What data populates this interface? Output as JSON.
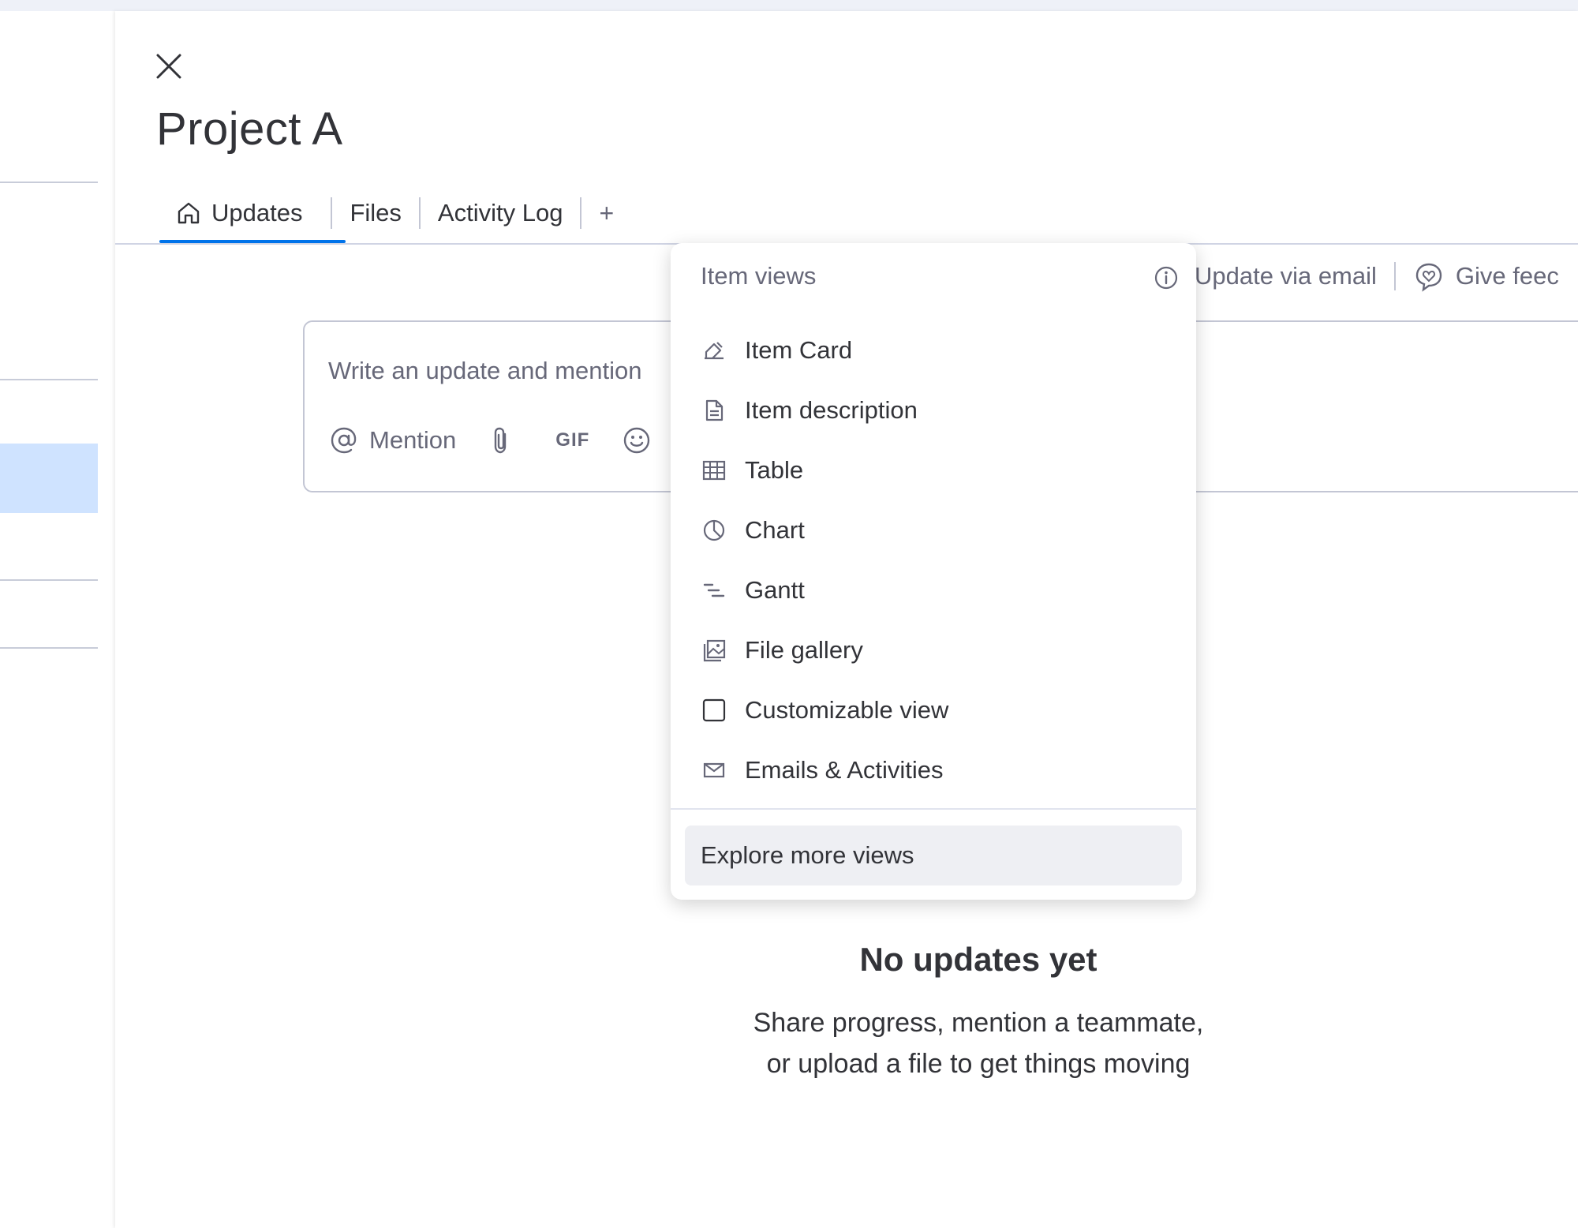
{
  "panel": {
    "title": "Project A"
  },
  "tabs": [
    {
      "label": "Updates",
      "icon": "home-icon",
      "active": true
    },
    {
      "label": "Files"
    },
    {
      "label": "Activity Log"
    }
  ],
  "tab_add_label": "+",
  "right_actions": {
    "update_via_email": "Update via email",
    "give_feedback": "Give feec"
  },
  "composer": {
    "placeholder": "Write an update and mention",
    "mention_label": "Mention",
    "gif_label": "GIF"
  },
  "dropdown": {
    "header": "Item views",
    "items": [
      {
        "label": "Item Card",
        "icon": "item-card-icon"
      },
      {
        "label": "Item description",
        "icon": "document-icon"
      },
      {
        "label": "Table",
        "icon": "table-icon"
      },
      {
        "label": "Chart",
        "icon": "chart-icon"
      },
      {
        "label": "Gantt",
        "icon": "gantt-icon"
      },
      {
        "label": "File gallery",
        "icon": "gallery-icon"
      },
      {
        "label": "Customizable view",
        "icon": "square-icon"
      },
      {
        "label": "Emails & Activities",
        "icon": "mail-icon"
      }
    ],
    "explore": "Explore more views"
  },
  "empty_state": {
    "title": "No updates yet",
    "line1": "Share progress, mention a teammate,",
    "line2": "or upload a file to get things moving"
  },
  "colors": {
    "accent": "#0073ea",
    "text": "#323338",
    "muted": "#676879",
    "selected_row": "#cfe3ff"
  }
}
